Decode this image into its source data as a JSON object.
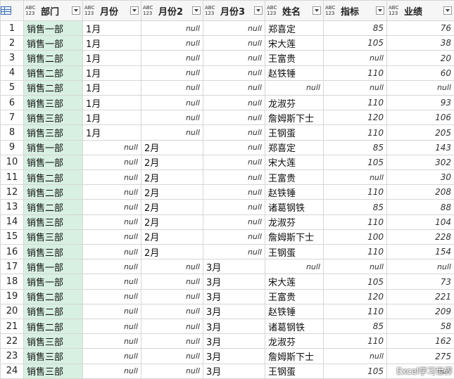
{
  "columns": [
    {
      "type": "ABC\n123",
      "label": "部门"
    },
    {
      "type": "ABC\n123",
      "label": "月份"
    },
    {
      "type": "ABC\n123",
      "label": "月份2"
    },
    {
      "type": "ABC\n123",
      "label": "月份3"
    },
    {
      "type": "ABC\n123",
      "label": "姓名"
    },
    {
      "type": "ABC\n123",
      "label": "指标"
    },
    {
      "type": "ABC\n123",
      "label": "业绩"
    }
  ],
  "rows": [
    [
      "销售一部",
      "1月",
      "null",
      "null",
      "郑喜定",
      "85",
      "76"
    ],
    [
      "销售一部",
      "1月",
      "null",
      "null",
      "宋大莲",
      "105",
      "38"
    ],
    [
      "销售二部",
      "1月",
      "null",
      "null",
      "王富贵",
      "null",
      "20"
    ],
    [
      "销售二部",
      "1月",
      "null",
      "null",
      "赵铁锤",
      "110",
      "60"
    ],
    [
      "销售二部",
      "1月",
      "null",
      "null",
      "null",
      "null",
      "null"
    ],
    [
      "销售三部",
      "1月",
      "null",
      "null",
      "龙淑芬",
      "110",
      "93"
    ],
    [
      "销售三部",
      "1月",
      "null",
      "null",
      "詹姆斯下士",
      "120",
      "106"
    ],
    [
      "销售三部",
      "1月",
      "null",
      "null",
      "王钢蛋",
      "110",
      "205"
    ],
    [
      "销售一部",
      "null",
      "2月",
      "null",
      "郑喜定",
      "85",
      "143"
    ],
    [
      "销售一部",
      "null",
      "2月",
      "null",
      "宋大莲",
      "105",
      "302"
    ],
    [
      "销售二部",
      "null",
      "2月",
      "null",
      "王富贵",
      "null",
      "30"
    ],
    [
      "销售二部",
      "null",
      "2月",
      "null",
      "赵铁锤",
      "110",
      "208"
    ],
    [
      "销售二部",
      "null",
      "2月",
      "null",
      "诸葛钢铁",
      "85",
      "88"
    ],
    [
      "销售三部",
      "null",
      "2月",
      "null",
      "龙淑芬",
      "110",
      "104"
    ],
    [
      "销售三部",
      "null",
      "2月",
      "null",
      "詹姆斯下士",
      "100",
      "228"
    ],
    [
      "销售三部",
      "null",
      "2月",
      "null",
      "王钢蛋",
      "110",
      "154"
    ],
    [
      "销售一部",
      "null",
      "null",
      "3月",
      "null",
      "null",
      "null"
    ],
    [
      "销售一部",
      "null",
      "null",
      "3月",
      "宋大莲",
      "105",
      "73"
    ],
    [
      "销售二部",
      "null",
      "null",
      "3月",
      "王富贵",
      "120",
      "221"
    ],
    [
      "销售二部",
      "null",
      "null",
      "3月",
      "赵铁锤",
      "110",
      "209"
    ],
    [
      "销售二部",
      "null",
      "null",
      "3月",
      "诸葛钢铁",
      "85",
      "58"
    ],
    [
      "销售三部",
      "null",
      "null",
      "3月",
      "龙淑芬",
      "110",
      "162"
    ],
    [
      "销售三部",
      "null",
      "null",
      "3月",
      "詹姆斯下士",
      "null",
      "275"
    ],
    [
      "销售三部",
      "null",
      "null",
      "3月",
      "王钢蛋",
      "105",
      "null"
    ]
  ],
  "watermark": "Excel学习世界"
}
